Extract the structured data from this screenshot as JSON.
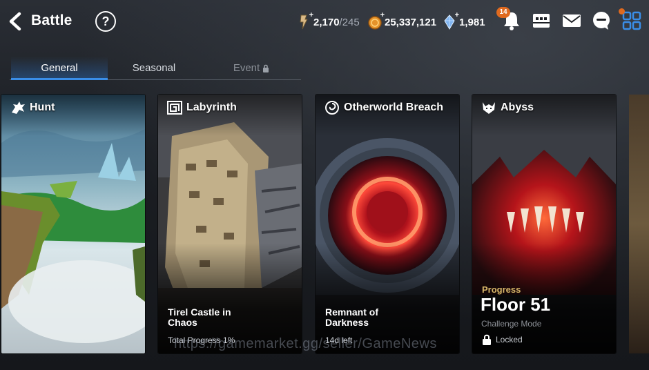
{
  "header": {
    "title": "Battle",
    "help_label": "?",
    "stamina": {
      "current": "2,170",
      "max": "/245",
      "icon": "stamina-key-icon"
    },
    "gold": {
      "value": "25,337,121",
      "icon": "gold-coin-icon"
    },
    "crystal": {
      "value": "1,981",
      "icon": "crystal-icon"
    },
    "notifications": {
      "count": "14",
      "icon": "bell-icon"
    },
    "other_icons": [
      "guild-icon",
      "mail-icon",
      "chat-icon",
      "menu-grid-icon"
    ]
  },
  "tabs": [
    {
      "label": "General",
      "state": "active"
    },
    {
      "label": "Seasonal",
      "state": "normal"
    },
    {
      "label": "Event",
      "state": "locked"
    }
  ],
  "cards": [
    {
      "name": "Hunt",
      "icon": "dragon-icon"
    },
    {
      "name": "Labyrinth",
      "icon": "maze-icon",
      "subtitle": "Tirel Castle in Chaos",
      "meta": "Total Progress 1%"
    },
    {
      "name": "Otherworld Breach",
      "icon": "swirl-icon",
      "subtitle": "Remnant of Darkness",
      "meta": "14d left"
    },
    {
      "name": "Abyss",
      "icon": "demon-icon",
      "progress_label": "Progress",
      "floor": "Floor 51",
      "mode": "Challenge Mode",
      "status": "Locked"
    }
  ],
  "watermark": "https://gamemarket.gg/seller/GameNews",
  "colors": {
    "accent": "#3a8ee8",
    "badge": "#e06a1f",
    "gold": "#d9b86a"
  }
}
